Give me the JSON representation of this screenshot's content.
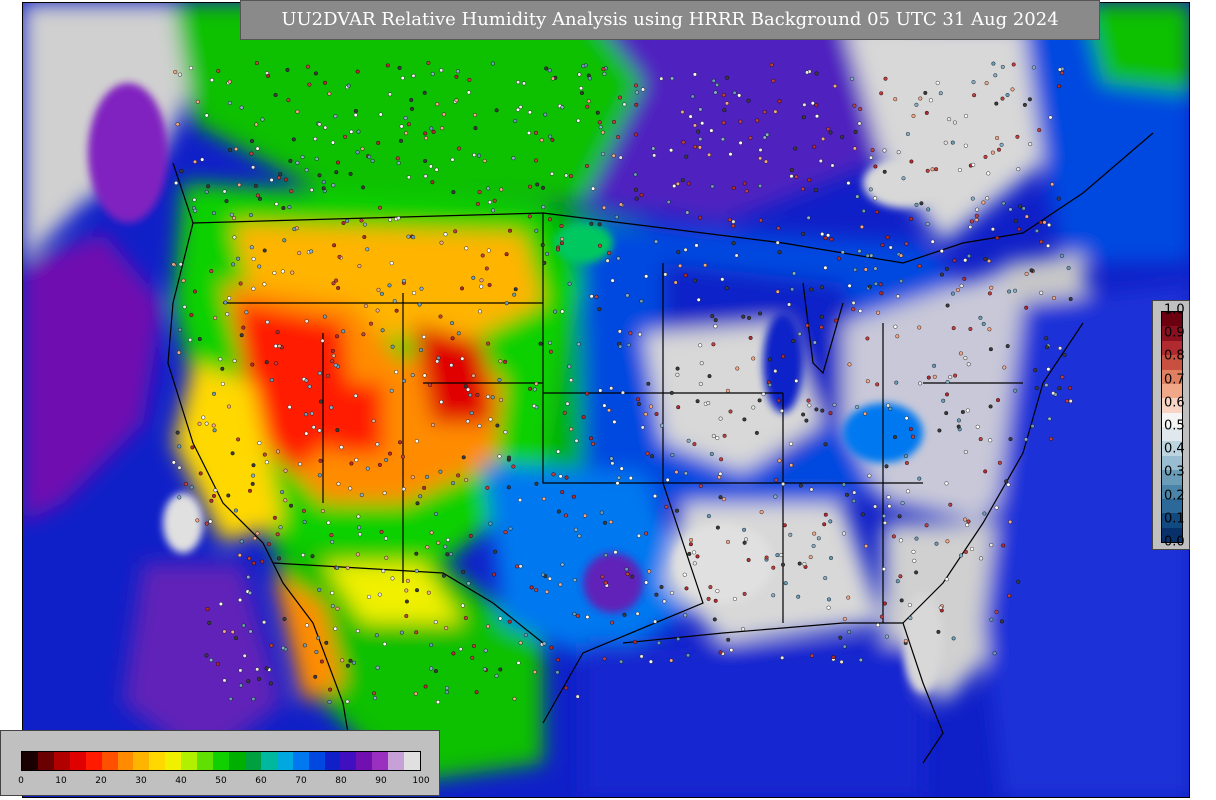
{
  "title": "UU2DVAR Relative Humidity Analysis using HRRR Background 05 UTC 31 Aug 2024",
  "rh_colorbar": {
    "ticks": [
      "0",
      "10",
      "20",
      "30",
      "40",
      "50",
      "60",
      "70",
      "80",
      "90",
      "100"
    ],
    "colors": [
      "#1a0000",
      "#6a0000",
      "#b00000",
      "#e00000",
      "#ff1a00",
      "#ff5000",
      "#ff8c00",
      "#ffb400",
      "#ffd800",
      "#f0f000",
      "#b0f000",
      "#60e000",
      "#10d000",
      "#00b000",
      "#00a040",
      "#00b8a0",
      "#00a8e0",
      "#0078f0",
      "#0048e0",
      "#1020c8",
      "#4010c0",
      "#7010b0",
      "#9a30c0",
      "#c8a0d8",
      "#e0e0e0"
    ]
  },
  "qc_colorbar": {
    "ticks": [
      "1.0",
      "0.9",
      "0.8",
      "0.7",
      "0.6",
      "0.5",
      "0.4",
      "0.3",
      "0.2",
      "0.1",
      "0.0"
    ],
    "colors": [
      "#6b0010",
      "#8a1020",
      "#b02a30",
      "#c85040",
      "#e08060",
      "#f0a888",
      "#f8d4c4",
      "#f4f4f4",
      "#e0e8ee",
      "#bcd4e0",
      "#98bcd0",
      "#6a9cb8",
      "#4a84a8",
      "#2c6898",
      "#104a80",
      "#08306a"
    ]
  },
  "map_regions": [
    {
      "name": "pacific-ocean",
      "color": "#1020c8"
    },
    {
      "name": "western-dry-core",
      "color": "#ff1a00"
    },
    {
      "name": "intermountain-orange",
      "color": "#ff8c00"
    },
    {
      "name": "northern-plains-yellow",
      "color": "#ffd800"
    },
    {
      "name": "plains-green",
      "color": "#10d000"
    },
    {
      "name": "midwest-blue",
      "color": "#0048e0"
    },
    {
      "name": "eastern-saturated",
      "color": "#d8d8d8"
    },
    {
      "name": "canada-purple",
      "color": "#7010b0"
    },
    {
      "name": "atlantic-ocean",
      "color": "#1020c8"
    },
    {
      "name": "gulf-of-mexico",
      "color": "#1428d0"
    }
  ]
}
